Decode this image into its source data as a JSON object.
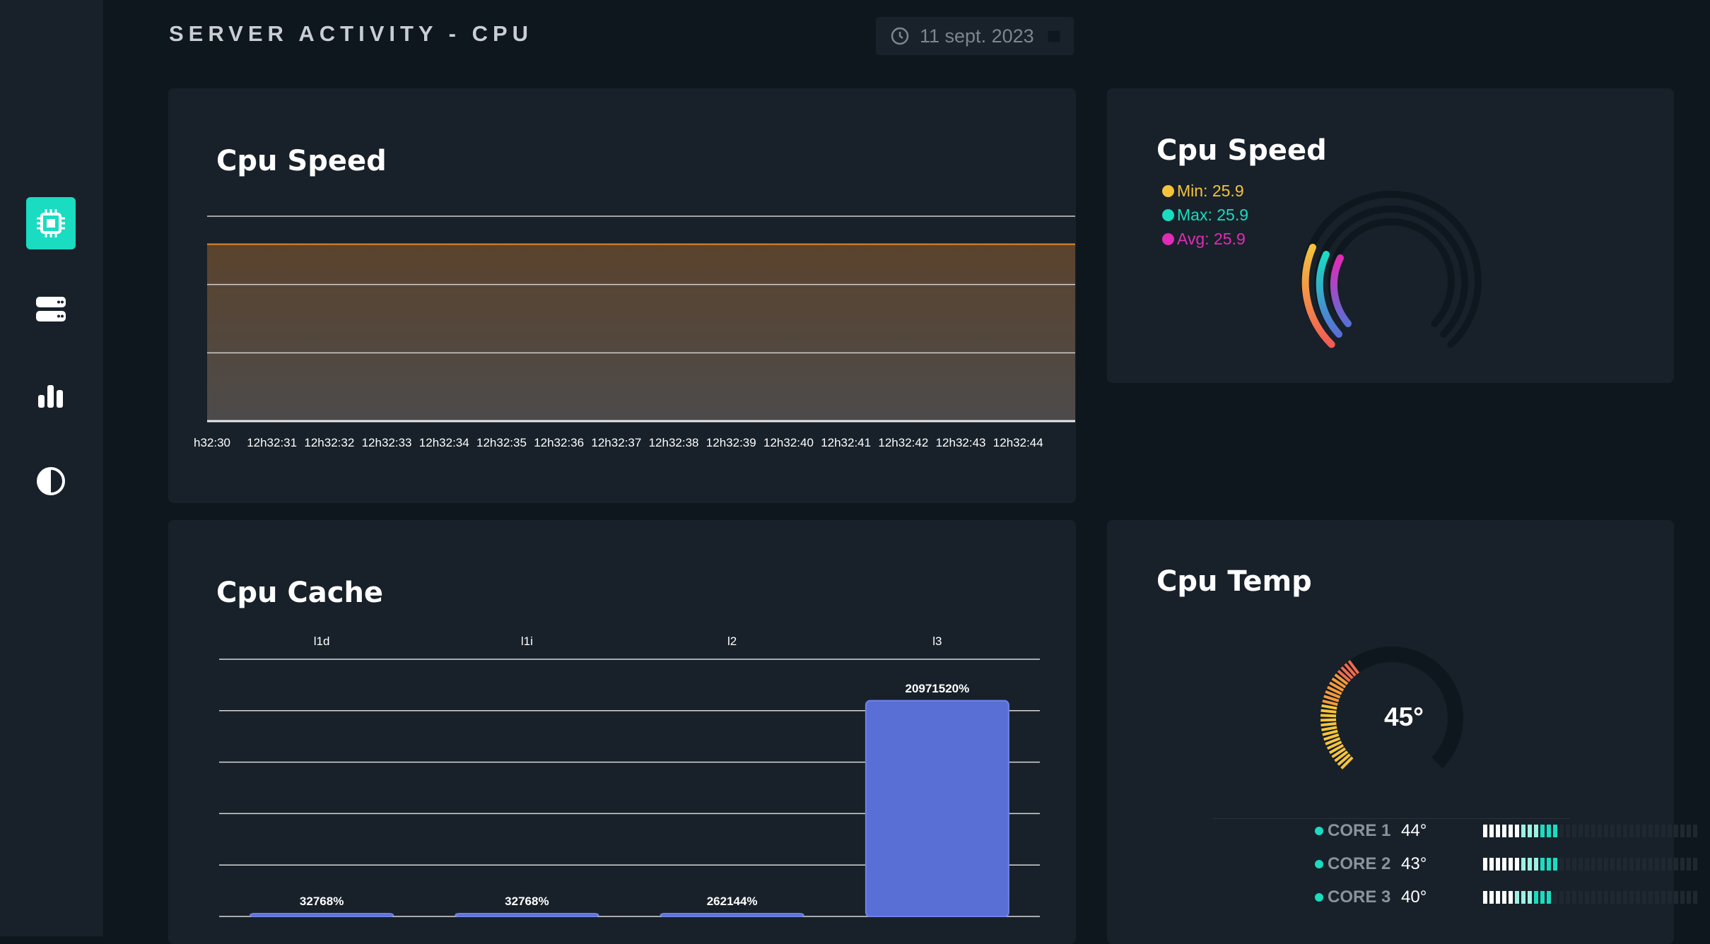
{
  "header": {
    "title": "SERVER ACTIVITY - CPU",
    "date": "11 sept. 2023"
  },
  "sidebar": {
    "items": [
      {
        "name": "cpu",
        "icon": "cpu-icon",
        "active": true
      },
      {
        "name": "servers",
        "icon": "server-icon",
        "active": false
      },
      {
        "name": "stats",
        "icon": "bar-chart-icon",
        "active": false
      },
      {
        "name": "theme",
        "icon": "contrast-icon",
        "active": false
      }
    ]
  },
  "colors": {
    "accent": "#19dcc1",
    "card": "#18212a",
    "background": "#0f171e",
    "bar": "#5a6fd6",
    "min": "#f5c33b",
    "max": "#19dcc1",
    "avg": "#e22bb6"
  },
  "cpu_speed_chart": {
    "title": "Cpu Speed",
    "chart_data": {
      "type": "area",
      "x": [
        "h32:30",
        "12h32:31",
        "12h32:32",
        "12h32:33",
        "12h32:34",
        "12h32:35",
        "12h32:36",
        "12h32:37",
        "12h32:38",
        "12h32:39",
        "12h32:40",
        "12h32:41",
        "12h32:42",
        "12h32:43",
        "12h32:44"
      ],
      "series": [
        {
          "values": [
            25.9,
            25.9,
            25.9,
            25.9,
            25.9,
            25.9,
            25.9,
            25.9,
            25.9,
            25.9,
            25.9,
            25.9,
            25.9,
            25.9,
            25.9
          ]
        }
      ],
      "ylim": [
        0,
        30
      ],
      "grid": true
    }
  },
  "cpu_speed_gauge": {
    "title": "Cpu Speed",
    "min": "Min: 25.9",
    "max": "Max: 25.9",
    "avg": "Avg: 25.9"
  },
  "cpu_cache": {
    "title": "Cpu Cache",
    "chart_data": {
      "type": "bar",
      "categories": [
        "l1d",
        "l1i",
        "l2",
        "l3"
      ],
      "values": [
        32768,
        32768,
        262144,
        20971520
      ],
      "value_labels": [
        "32768%",
        "32768%",
        "262144%",
        "20971520%"
      ],
      "ylim": [
        0,
        25000000
      ],
      "grid": true
    }
  },
  "cpu_temp": {
    "title": "Cpu Temp",
    "value": "45°",
    "cores": [
      {
        "name": "CORE 1",
        "temp": "44°",
        "level": 0.35
      },
      {
        "name": "CORE 2",
        "temp": "43°",
        "level": 0.35
      },
      {
        "name": "CORE 3",
        "temp": "40°",
        "level": 0.31
      }
    ]
  }
}
